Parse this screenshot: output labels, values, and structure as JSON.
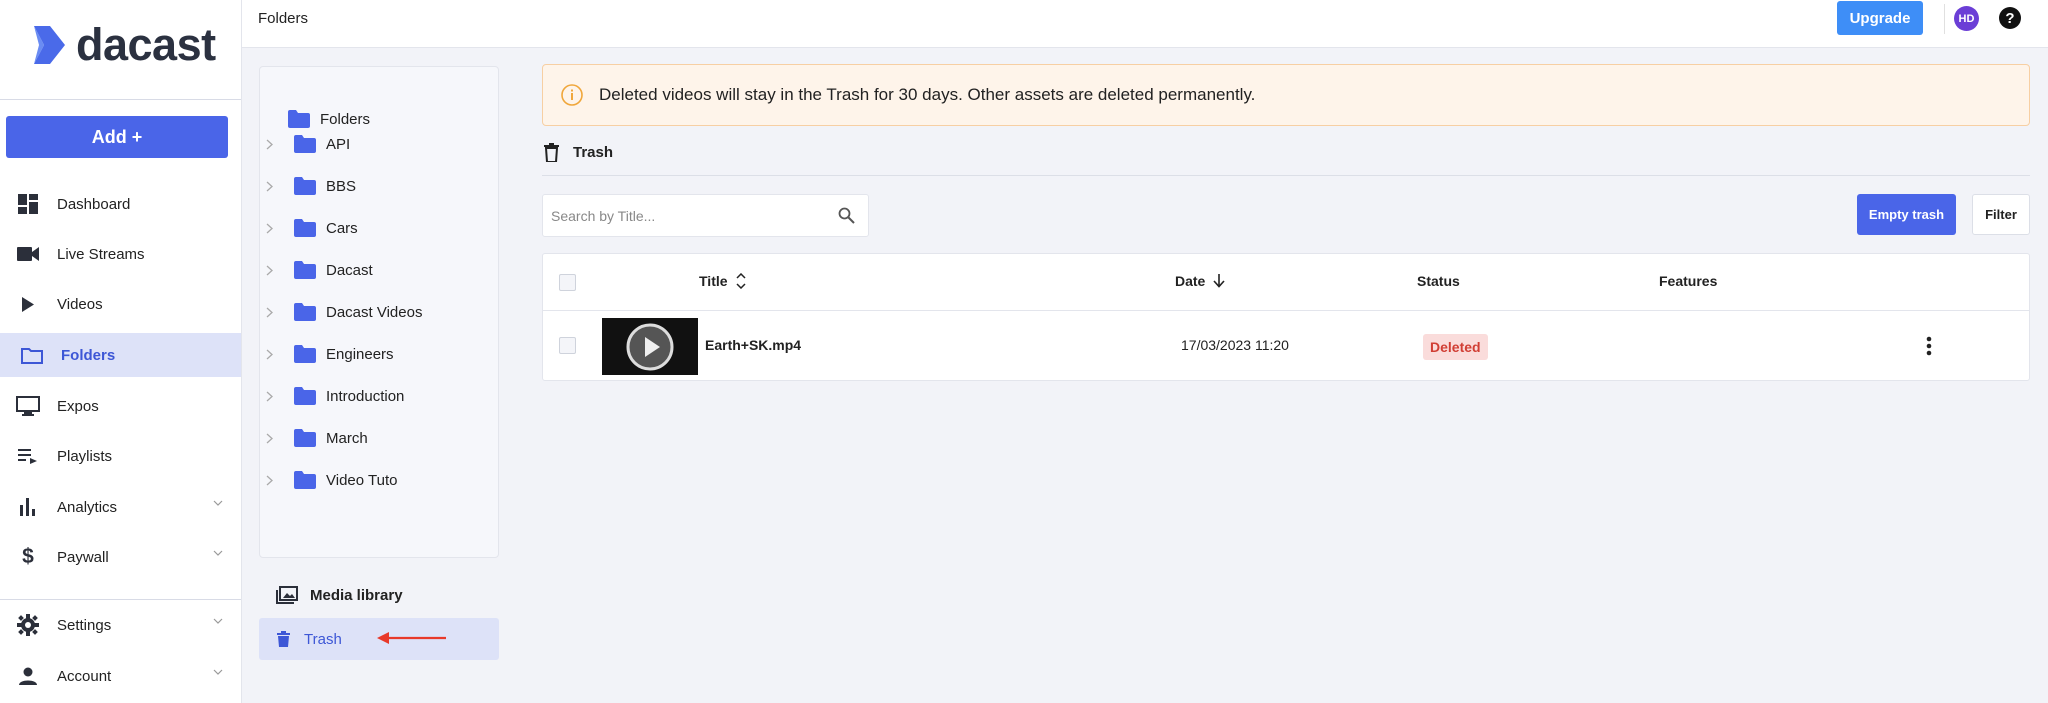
{
  "brand": {
    "name": "dacast"
  },
  "sidebar": {
    "add_label": "Add +",
    "items": [
      {
        "label": "Dashboard",
        "icon": "dashboard-icon"
      },
      {
        "label": "Live Streams",
        "icon": "video-camera-icon"
      },
      {
        "label": "Videos",
        "icon": "play-icon"
      },
      {
        "label": "Folders",
        "icon": "folder-icon",
        "active": true
      },
      {
        "label": "Expos",
        "icon": "monitor-icon"
      },
      {
        "label": "Playlists",
        "icon": "playlist-icon"
      },
      {
        "label": "Analytics",
        "icon": "bar-chart-icon"
      },
      {
        "label": "Paywall",
        "icon": "dollar-icon"
      },
      {
        "label": "Settings",
        "icon": "gear-icon"
      },
      {
        "label": "Account",
        "icon": "person-icon"
      }
    ]
  },
  "header": {
    "title": "Folders",
    "upgrade_label": "Upgrade",
    "avatar_initials": "HD"
  },
  "folders": {
    "root_label": "Folders",
    "items": [
      "API",
      "BBS",
      "Cars",
      "Dacast",
      "Dacast Videos",
      "Engineers",
      "Introduction",
      "March",
      "Video Tuto"
    ],
    "media_library_label": "Media library",
    "trash_label": "Trash"
  },
  "main": {
    "banner_text": "Deleted videos will stay in the Trash for 30 days. Other assets are deleted permanently.",
    "section_title": "Trash",
    "search_placeholder": "Search by Title...",
    "empty_trash_label": "Empty trash",
    "filter_label": "Filter",
    "columns": {
      "title": "Title",
      "date": "Date",
      "status": "Status",
      "features": "Features"
    },
    "rows": [
      {
        "title": "Earth+SK.mp4",
        "date": "17/03/2023 11:20",
        "status": "Deleted"
      }
    ]
  },
  "colors": {
    "accent": "#4a65e8",
    "upgrade": "#3e8ef7",
    "avatar": "#6b3ed6",
    "deleted_badge_bg": "#fadcdb",
    "deleted_badge_text": "#d13f35"
  }
}
